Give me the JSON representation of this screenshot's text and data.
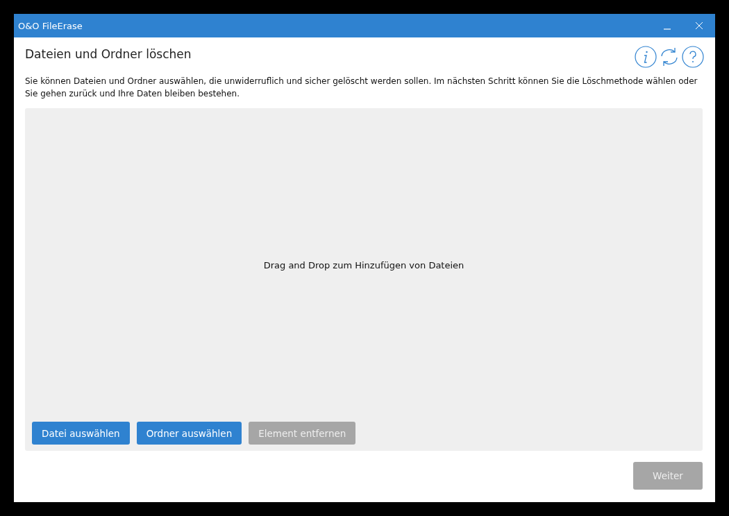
{
  "window": {
    "title": "O&O FileErase"
  },
  "heading": "Dateien und Ordner löschen",
  "description": "Sie können Dateien und Ordner auswählen, die unwiderruflich und sicher gelöscht werden sollen.  Im nächsten Schritt können Sie die Löschmethode wählen oder Sie gehen zurück und Ihre Daten bleiben bestehen.",
  "drop_area": {
    "hint": "Drag and Drop zum Hinzufügen von Dateien",
    "buttons": [
      {
        "label": "Datei auswählen",
        "disabled": false
      },
      {
        "label": "Ordner auswählen",
        "disabled": false
      },
      {
        "label": "Element entfernen",
        "disabled": true
      }
    ]
  },
  "next_button": {
    "label": "Weiter",
    "disabled": true
  }
}
